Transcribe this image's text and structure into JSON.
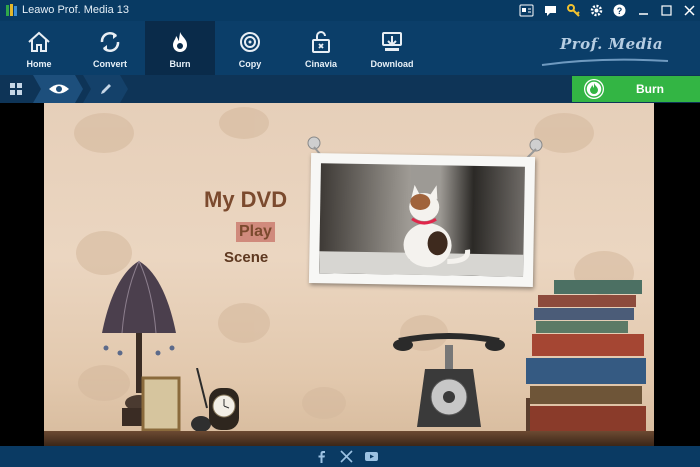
{
  "window": {
    "title": "Leawo Prof. Media 13"
  },
  "titlebar_icons": [
    "register-icon",
    "chat-icon",
    "key-icon",
    "gear-icon",
    "help-icon",
    "minimize-icon",
    "maximize-icon",
    "close-icon"
  ],
  "toolbar": {
    "items": [
      {
        "label": "Home",
        "icon": "home-icon"
      },
      {
        "label": "Convert",
        "icon": "convert-icon"
      },
      {
        "label": "Burn",
        "icon": "burn-icon",
        "active": true
      },
      {
        "label": "Copy",
        "icon": "copy-icon"
      },
      {
        "label": "Cinavia",
        "icon": "cinavia-icon"
      },
      {
        "label": "Download",
        "icon": "download-icon"
      }
    ],
    "brand": "Prof. Media"
  },
  "subbar": {
    "icons": [
      "grid-icon",
      "eye-icon",
      "pencil-icon"
    ],
    "burn_button": "Burn"
  },
  "menu": {
    "title": "My DVD",
    "play": "Play",
    "scene": "Scene"
  },
  "footer": {
    "icons": [
      "facebook-icon",
      "twitter-icon",
      "youtube-icon"
    ]
  },
  "colors": {
    "accent_green": "#33b544",
    "toolbar_blue": "#0b3e69",
    "menu_brown": "#7b4a2e"
  }
}
